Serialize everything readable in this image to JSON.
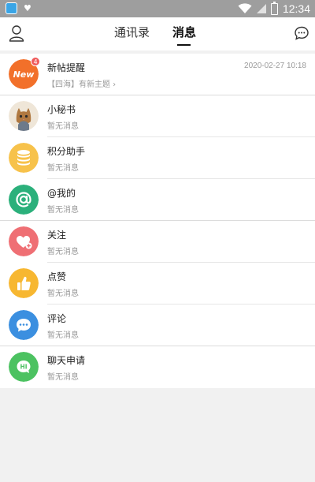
{
  "status_bar": {
    "time": "12:34"
  },
  "nav": {
    "tabs": [
      {
        "label": "通讯录"
      },
      {
        "label": "消息"
      }
    ]
  },
  "messages": [
    {
      "title": "新帖提醒",
      "subtitle": "【四海】有新主题 ›",
      "time": "2020-02-27 10:18",
      "badge": "4",
      "avatar_text": "New"
    },
    {
      "title": "小秘书",
      "subtitle": "暂无消息"
    },
    {
      "title": "积分助手",
      "subtitle": "暂无消息"
    },
    {
      "title": "@我的",
      "subtitle": "暂无消息"
    },
    {
      "title": "关注",
      "subtitle": "暂无消息"
    },
    {
      "title": "点赞",
      "subtitle": "暂无消息"
    },
    {
      "title": "评论",
      "subtitle": "暂无消息"
    },
    {
      "title": "聊天申请",
      "subtitle": "暂无消息",
      "avatar_text": "HI"
    }
  ],
  "colors": {
    "new": "#f2702a",
    "points": "#f7c24b",
    "at": "#2bb07b",
    "follow": "#ef6f74",
    "like": "#f7b731",
    "comment": "#3b8fe0",
    "chat_request": "#4cc261"
  }
}
